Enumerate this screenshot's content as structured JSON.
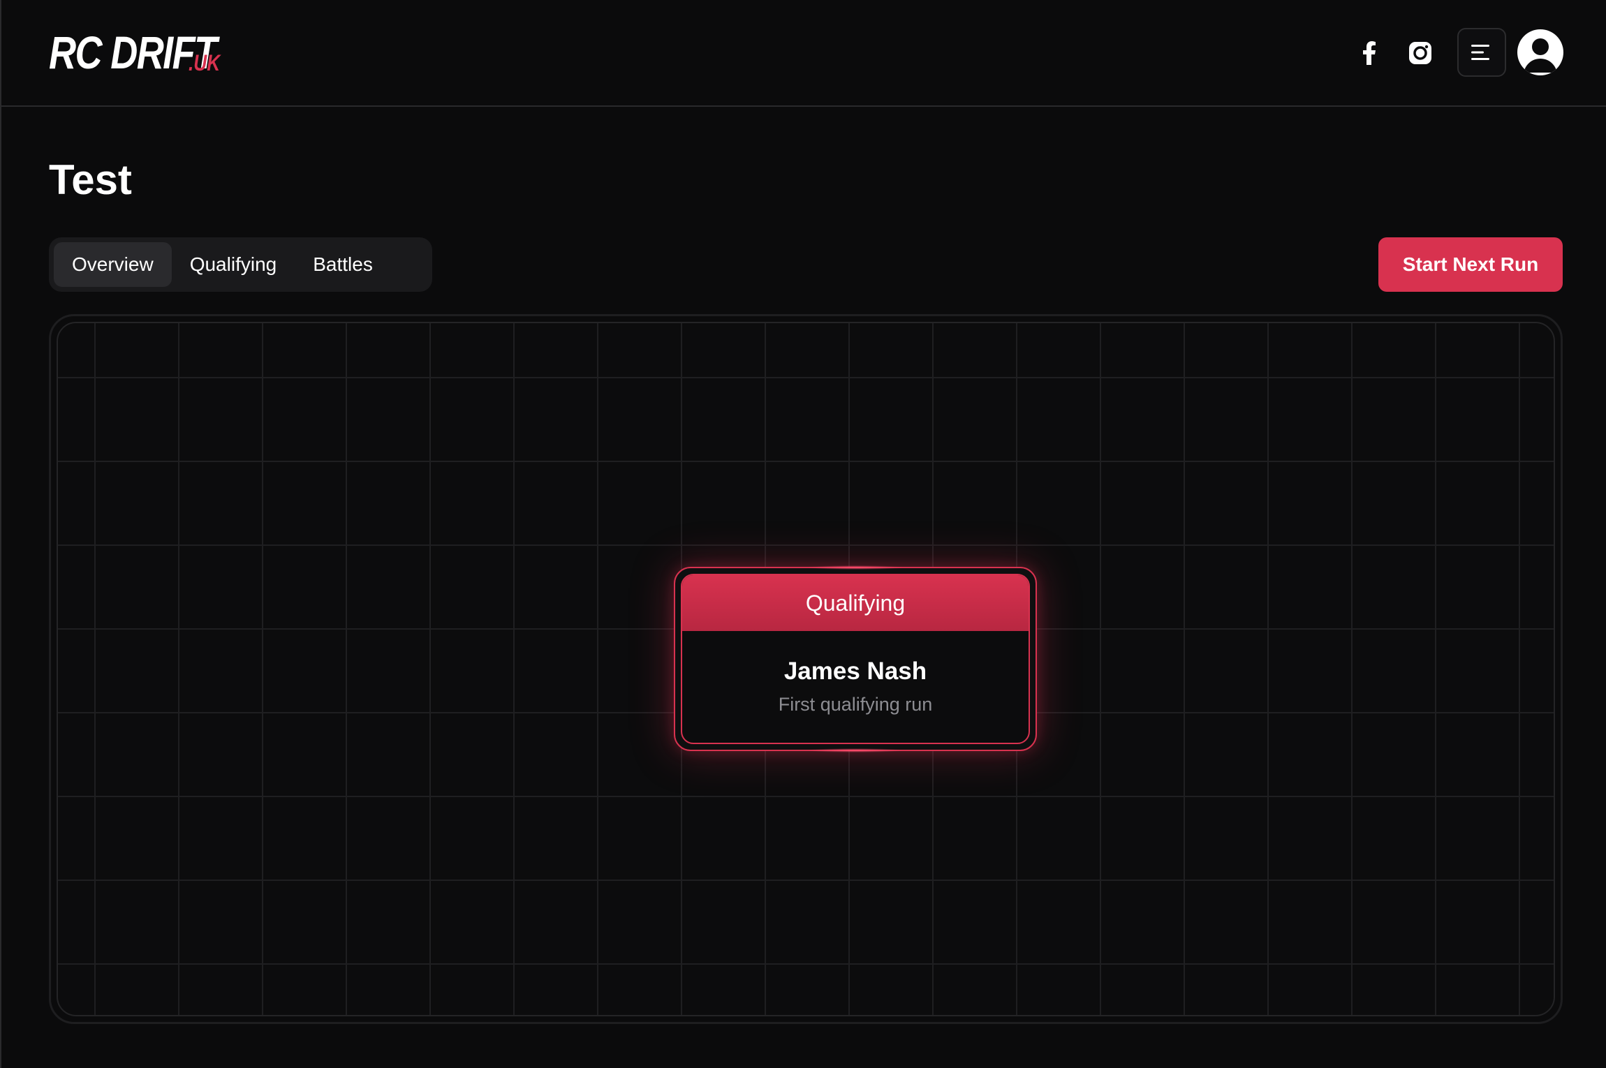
{
  "header": {
    "logo_main": "RC DRIFT",
    "logo_suffix": ".UK",
    "icons": [
      "facebook-icon",
      "instagram-icon",
      "menu-icon",
      "user-avatar-icon"
    ]
  },
  "page": {
    "title": "Test"
  },
  "tabs": [
    {
      "label": "Overview",
      "active": true
    },
    {
      "label": "Qualifying",
      "active": false
    },
    {
      "label": "Battles",
      "active": false
    }
  ],
  "actions": {
    "start_next_run": "Start Next Run"
  },
  "node": {
    "header": "Qualifying",
    "driver": "James Nash",
    "subtitle": "First qualifying run"
  },
  "colors": {
    "accent": "#d8324f",
    "background": "#0b0b0c"
  }
}
